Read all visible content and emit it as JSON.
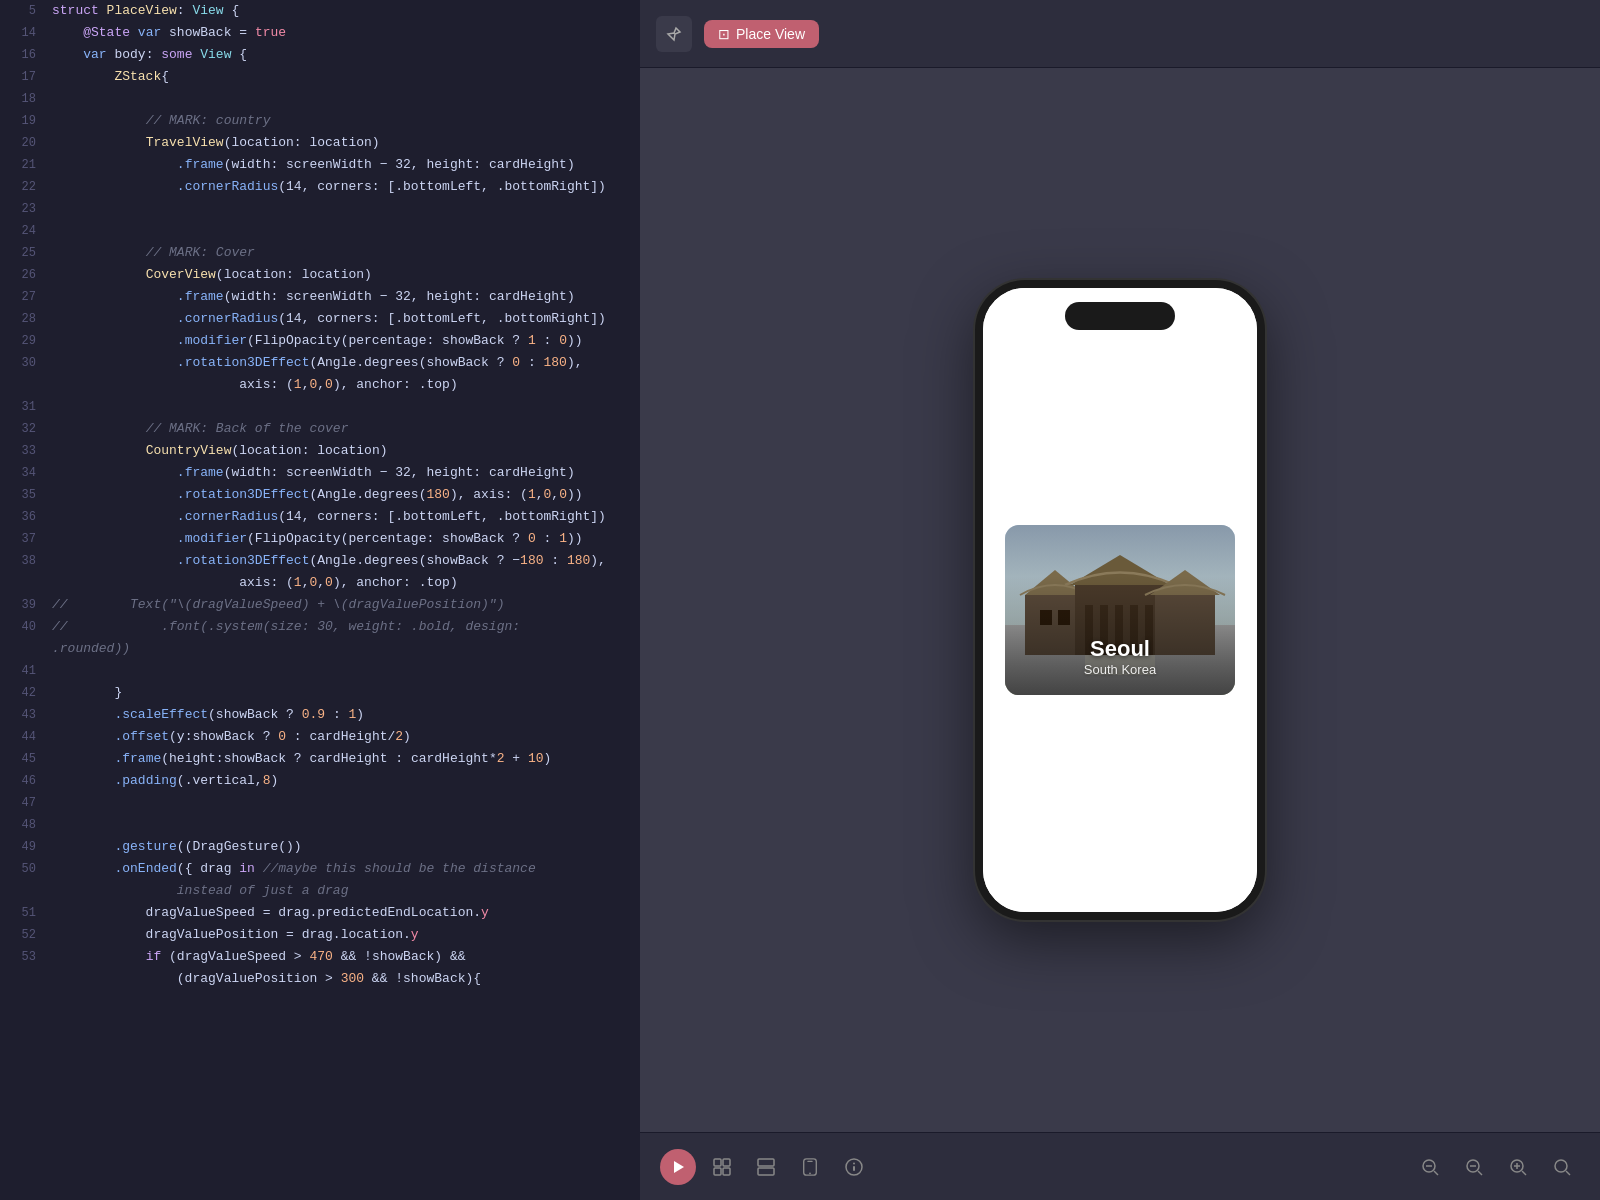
{
  "editor": {
    "lines": [
      {
        "num": "5",
        "tokens": [
          {
            "text": "struct ",
            "cls": "kw"
          },
          {
            "text": "PlaceView",
            "cls": "struct-name"
          },
          {
            "text": ": ",
            "cls": "code-text"
          },
          {
            "text": "View",
            "cls": "type"
          },
          {
            "text": " {",
            "cls": "code-text"
          }
        ]
      },
      {
        "num": "14",
        "tokens": [
          {
            "text": "    @State ",
            "cls": "kw"
          },
          {
            "text": "var ",
            "cls": "kw2"
          },
          {
            "text": "showBack",
            "cls": "code-text"
          },
          {
            "text": " = ",
            "cls": "code-text"
          },
          {
            "text": "true",
            "cls": "true-kw"
          }
        ]
      },
      {
        "num": "16",
        "tokens": [
          {
            "text": "    var ",
            "cls": "kw2"
          },
          {
            "text": "body",
            "cls": "code-text"
          },
          {
            "text": ": ",
            "cls": "code-text"
          },
          {
            "text": "some ",
            "cls": "kw"
          },
          {
            "text": "View",
            "cls": "type"
          },
          {
            "text": " {",
            "cls": "code-text"
          }
        ]
      },
      {
        "num": "17",
        "tokens": [
          {
            "text": "        ZStack",
            "cls": "struct-name"
          },
          {
            "text": "{",
            "cls": "code-text"
          }
        ]
      },
      {
        "num": "18",
        "tokens": []
      },
      {
        "num": "19",
        "tokens": [
          {
            "text": "            ",
            "cls": "code-text"
          },
          {
            "text": "// MARK: country",
            "cls": "comment"
          }
        ]
      },
      {
        "num": "20",
        "tokens": [
          {
            "text": "            ",
            "cls": "code-text"
          },
          {
            "text": "TravelView",
            "cls": "struct-name"
          },
          {
            "text": "(location: location)",
            "cls": "code-text"
          }
        ]
      },
      {
        "num": "21",
        "tokens": [
          {
            "text": "                ",
            "cls": "code-text"
          },
          {
            "text": ".frame",
            "cls": "method"
          },
          {
            "text": "(width: screenWidth − 32, height: cardHeight)",
            "cls": "code-text"
          }
        ]
      },
      {
        "num": "22",
        "tokens": [
          {
            "text": "                ",
            "cls": "code-text"
          },
          {
            "text": ".cornerRadius",
            "cls": "method"
          },
          {
            "text": "(14, corners: [.bottomLeft, .bottomRight])",
            "cls": "code-text"
          }
        ]
      },
      {
        "num": "23",
        "tokens": []
      },
      {
        "num": "24",
        "tokens": []
      },
      {
        "num": "25",
        "tokens": [
          {
            "text": "            ",
            "cls": "code-text"
          },
          {
            "text": "// MARK: Cover",
            "cls": "comment"
          }
        ]
      },
      {
        "num": "26",
        "tokens": [
          {
            "text": "            ",
            "cls": "code-text"
          },
          {
            "text": "CoverView",
            "cls": "struct-name"
          },
          {
            "text": "(location: location)",
            "cls": "code-text"
          }
        ]
      },
      {
        "num": "27",
        "tokens": [
          {
            "text": "                ",
            "cls": "code-text"
          },
          {
            "text": ".frame",
            "cls": "method"
          },
          {
            "text": "(width: screenWidth − 32, height: cardHeight)",
            "cls": "code-text"
          }
        ]
      },
      {
        "num": "28",
        "tokens": [
          {
            "text": "                ",
            "cls": "code-text"
          },
          {
            "text": ".cornerRadius",
            "cls": "method"
          },
          {
            "text": "(14, corners: [.bottomLeft, .bottomRight])",
            "cls": "code-text"
          }
        ]
      },
      {
        "num": "29",
        "tokens": [
          {
            "text": "                ",
            "cls": "code-text"
          },
          {
            "text": ".modifier",
            "cls": "method"
          },
          {
            "text": "(FlipOpacity(percentage: showBack ? ",
            "cls": "code-text"
          },
          {
            "text": "1",
            "cls": "num"
          },
          {
            "text": " : ",
            "cls": "code-text"
          },
          {
            "text": "0",
            "cls": "num"
          },
          {
            "text": "))",
            "cls": "code-text"
          }
        ]
      },
      {
        "num": "30",
        "tokens": [
          {
            "text": "                ",
            "cls": "code-text"
          },
          {
            "text": ".rotation3DEffect",
            "cls": "method"
          },
          {
            "text": "(Angle.degrees(showBack ? ",
            "cls": "code-text"
          },
          {
            "text": "0",
            "cls": "num"
          },
          {
            "text": " : ",
            "cls": "code-text"
          },
          {
            "text": "180",
            "cls": "num"
          },
          {
            "text": "),",
            "cls": "code-text"
          }
        ]
      },
      {
        "num": "",
        "tokens": [
          {
            "text": "                        axis: (",
            "cls": "code-text"
          },
          {
            "text": "1",
            "cls": "num"
          },
          {
            "text": ",",
            "cls": "code-text"
          },
          {
            "text": "0",
            "cls": "num"
          },
          {
            "text": ",",
            "cls": "code-text"
          },
          {
            "text": "0",
            "cls": "num"
          },
          {
            "text": "), anchor: .top)",
            "cls": "code-text"
          }
        ]
      },
      {
        "num": "31",
        "tokens": []
      },
      {
        "num": "32",
        "tokens": [
          {
            "text": "            ",
            "cls": "code-text"
          },
          {
            "text": "// MARK: Back of the cover",
            "cls": "comment"
          }
        ]
      },
      {
        "num": "33",
        "tokens": [
          {
            "text": "            ",
            "cls": "code-text"
          },
          {
            "text": "CountryView",
            "cls": "struct-name"
          },
          {
            "text": "(location: location)",
            "cls": "code-text"
          }
        ]
      },
      {
        "num": "34",
        "tokens": [
          {
            "text": "                ",
            "cls": "code-text"
          },
          {
            "text": ".frame",
            "cls": "method"
          },
          {
            "text": "(width: screenWidth − 32, height: cardHeight)",
            "cls": "code-text"
          }
        ]
      },
      {
        "num": "35",
        "tokens": [
          {
            "text": "                ",
            "cls": "code-text"
          },
          {
            "text": ".rotation3DEffect",
            "cls": "method"
          },
          {
            "text": "(Angle.degrees(",
            "cls": "code-text"
          },
          {
            "text": "180",
            "cls": "num"
          },
          {
            "text": "), axis: (",
            "cls": "code-text"
          },
          {
            "text": "1",
            "cls": "num"
          },
          {
            "text": ",",
            "cls": "code-text"
          },
          {
            "text": "0",
            "cls": "num"
          },
          {
            "text": ",",
            "cls": "code-text"
          },
          {
            "text": "0",
            "cls": "num"
          },
          {
            "text": "))",
            "cls": "code-text"
          }
        ]
      },
      {
        "num": "36",
        "tokens": [
          {
            "text": "                ",
            "cls": "code-text"
          },
          {
            "text": ".cornerRadius",
            "cls": "method"
          },
          {
            "text": "(14, corners: [.bottomLeft, .bottomRight])",
            "cls": "code-text"
          }
        ]
      },
      {
        "num": "37",
        "tokens": [
          {
            "text": "                ",
            "cls": "code-text"
          },
          {
            "text": ".modifier",
            "cls": "method"
          },
          {
            "text": "(FlipOpacity(percentage: showBack ? ",
            "cls": "code-text"
          },
          {
            "text": "0",
            "cls": "num"
          },
          {
            "text": " : ",
            "cls": "code-text"
          },
          {
            "text": "1",
            "cls": "num"
          },
          {
            "text": "))",
            "cls": "code-text"
          }
        ]
      },
      {
        "num": "38",
        "tokens": [
          {
            "text": "                ",
            "cls": "code-text"
          },
          {
            "text": ".rotation3DEffect",
            "cls": "method"
          },
          {
            "text": "(Angle.degrees(showBack ? −",
            "cls": "code-text"
          },
          {
            "text": "180",
            "cls": "num"
          },
          {
            "text": " : ",
            "cls": "code-text"
          },
          {
            "text": "180",
            "cls": "num"
          },
          {
            "text": "),",
            "cls": "code-text"
          }
        ]
      },
      {
        "num": "",
        "tokens": [
          {
            "text": "                        axis: (",
            "cls": "code-text"
          },
          {
            "text": "1",
            "cls": "num"
          },
          {
            "text": ",",
            "cls": "code-text"
          },
          {
            "text": "0",
            "cls": "num"
          },
          {
            "text": ",",
            "cls": "code-text"
          },
          {
            "text": "0",
            "cls": "num"
          },
          {
            "text": "), anchor: .top)",
            "cls": "code-text"
          }
        ]
      },
      {
        "num": "39",
        "tokens": [
          {
            "text": "//        ",
            "cls": "comment"
          },
          {
            "text": "Text(\"\\(dragValueSpeed) + \\(dragValuePosition)\")",
            "cls": "comment"
          }
        ]
      },
      {
        "num": "40",
        "tokens": [
          {
            "text": "//            .font(.system(size: 30, weight: .bold, design:",
            "cls": "comment"
          }
        ]
      },
      {
        "num": "",
        "tokens": [
          {
            "text": ".rounded))",
            "cls": "comment"
          }
        ]
      },
      {
        "num": "41",
        "tokens": []
      },
      {
        "num": "42",
        "tokens": [
          {
            "text": "        }",
            "cls": "code-text"
          }
        ]
      },
      {
        "num": "43",
        "tokens": [
          {
            "text": "        ",
            "cls": "code-text"
          },
          {
            "text": ".scaleEffect",
            "cls": "method"
          },
          {
            "text": "(showBack ? ",
            "cls": "code-text"
          },
          {
            "text": "0.9",
            "cls": "num"
          },
          {
            "text": " : ",
            "cls": "code-text"
          },
          {
            "text": "1",
            "cls": "num"
          },
          {
            "text": ")",
            "cls": "code-text"
          }
        ]
      },
      {
        "num": "44",
        "tokens": [
          {
            "text": "        ",
            "cls": "code-text"
          },
          {
            "text": ".offset",
            "cls": "method"
          },
          {
            "text": "(y:showBack ? ",
            "cls": "code-text"
          },
          {
            "text": "0",
            "cls": "num"
          },
          {
            "text": " : cardHeight/",
            "cls": "code-text"
          },
          {
            "text": "2",
            "cls": "num"
          },
          {
            "text": ")",
            "cls": "code-text"
          }
        ]
      },
      {
        "num": "45",
        "tokens": [
          {
            "text": "        ",
            "cls": "code-text"
          },
          {
            "text": ".frame",
            "cls": "method"
          },
          {
            "text": "(height:showBack ? cardHeight : cardHeight*",
            "cls": "code-text"
          },
          {
            "text": "2",
            "cls": "num"
          },
          {
            "text": " + ",
            "cls": "code-text"
          },
          {
            "text": "10",
            "cls": "num"
          },
          {
            "text": ")",
            "cls": "code-text"
          }
        ]
      },
      {
        "num": "46",
        "tokens": [
          {
            "text": "        ",
            "cls": "code-text"
          },
          {
            "text": ".padding",
            "cls": "method"
          },
          {
            "text": "(.vertical,",
            "cls": "code-text"
          },
          {
            "text": "8",
            "cls": "num"
          },
          {
            "text": ")",
            "cls": "code-text"
          }
        ]
      },
      {
        "num": "47",
        "tokens": []
      },
      {
        "num": "48",
        "tokens": []
      },
      {
        "num": "49",
        "tokens": [
          {
            "text": "        ",
            "cls": "code-text"
          },
          {
            "text": ".gesture",
            "cls": "method"
          },
          {
            "text": "((DragGesture())",
            "cls": "code-text"
          }
        ]
      },
      {
        "num": "50",
        "tokens": [
          {
            "text": "        ",
            "cls": "code-text"
          },
          {
            "text": ".onEnded",
            "cls": "method"
          },
          {
            "text": "({ drag ",
            "cls": "code-text"
          },
          {
            "text": "in ",
            "cls": "kw"
          },
          {
            "text": "//maybe this should be the distance",
            "cls": "comment"
          }
        ]
      },
      {
        "num": "",
        "tokens": [
          {
            "text": "                instead of just a drag",
            "cls": "comment"
          }
        ]
      },
      {
        "num": "51",
        "tokens": [
          {
            "text": "            dragValueSpeed = drag.predictedEndLocation.",
            "cls": "code-text"
          },
          {
            "text": "y",
            "cls": "param"
          }
        ]
      },
      {
        "num": "52",
        "tokens": [
          {
            "text": "            dragValuePosition = drag.location.",
            "cls": "code-text"
          },
          {
            "text": "y",
            "cls": "param"
          }
        ]
      },
      {
        "num": "53",
        "tokens": [
          {
            "text": "            ",
            "cls": "code-text"
          },
          {
            "text": "if ",
            "cls": "kw"
          },
          {
            "text": "(dragValueSpeed > ",
            "cls": "code-text"
          },
          {
            "text": "470",
            "cls": "num"
          },
          {
            "text": " && !showBack) &&",
            "cls": "code-text"
          }
        ]
      },
      {
        "num": "",
        "tokens": [
          {
            "text": "                (dragValuePosition > ",
            "cls": "code-text"
          },
          {
            "text": "300",
            "cls": "num"
          },
          {
            "text": " && !showBack){",
            "cls": "code-text"
          }
        ]
      }
    ]
  },
  "preview": {
    "title": "Place View",
    "pin_title": "pin",
    "phone": {
      "city": "Seoul",
      "country": "South Korea"
    }
  },
  "toolbar": {
    "play": "▶",
    "grid1": "⊞",
    "grid2": "⊟",
    "device": "📱",
    "info": "ⓘ",
    "zoom_out1": "−",
    "zoom_out2": "−",
    "zoom_in": "+",
    "zoom_fit": "⊡"
  }
}
